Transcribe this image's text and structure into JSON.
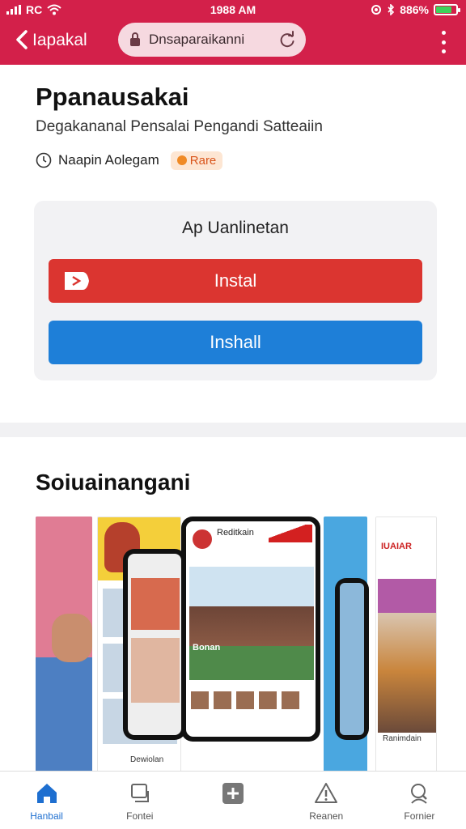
{
  "status": {
    "carrier": "RC",
    "time": "1988 AM",
    "battery_text": "886%",
    "battery_level": 0.78
  },
  "nav": {
    "title": "Iapakal",
    "url": "Dnsaparaikanni",
    "icons": [
      "back-icon",
      "lock-icon",
      "reload-icon",
      "kebab-icon"
    ]
  },
  "app": {
    "title": "Ppanausakai",
    "subtitle": "Degakananal Pensalai Pengandi Satteaiin",
    "developer": "Naapin Aolegam",
    "badge": "Rare"
  },
  "install": {
    "box_title": "Ap Uanlinetan",
    "install_label": "Instal",
    "uninstall_label": "Inshall",
    "colors": {
      "install": "#db3530",
      "uninstall": "#1e7fd8",
      "accent": "#d3204a"
    }
  },
  "screenshots": {
    "title": "Soiuainangani",
    "main_phone_label": "Reditkain",
    "main_phone_caption": "Bonan",
    "side_logo": "IUAIAR",
    "caption_left": "Dewiolan",
    "caption_right": "Ranimdain"
  },
  "tabs": [
    {
      "label": "Hanbail",
      "icon": "home-icon",
      "active": true
    },
    {
      "label": "Fontei",
      "icon": "monitor-icon",
      "active": false
    },
    {
      "label": "",
      "icon": "add-icon",
      "active": false
    },
    {
      "label": "Reanen",
      "icon": "alert-icon",
      "active": false
    },
    {
      "label": "Fornier",
      "icon": "search-icon",
      "active": false
    }
  ]
}
